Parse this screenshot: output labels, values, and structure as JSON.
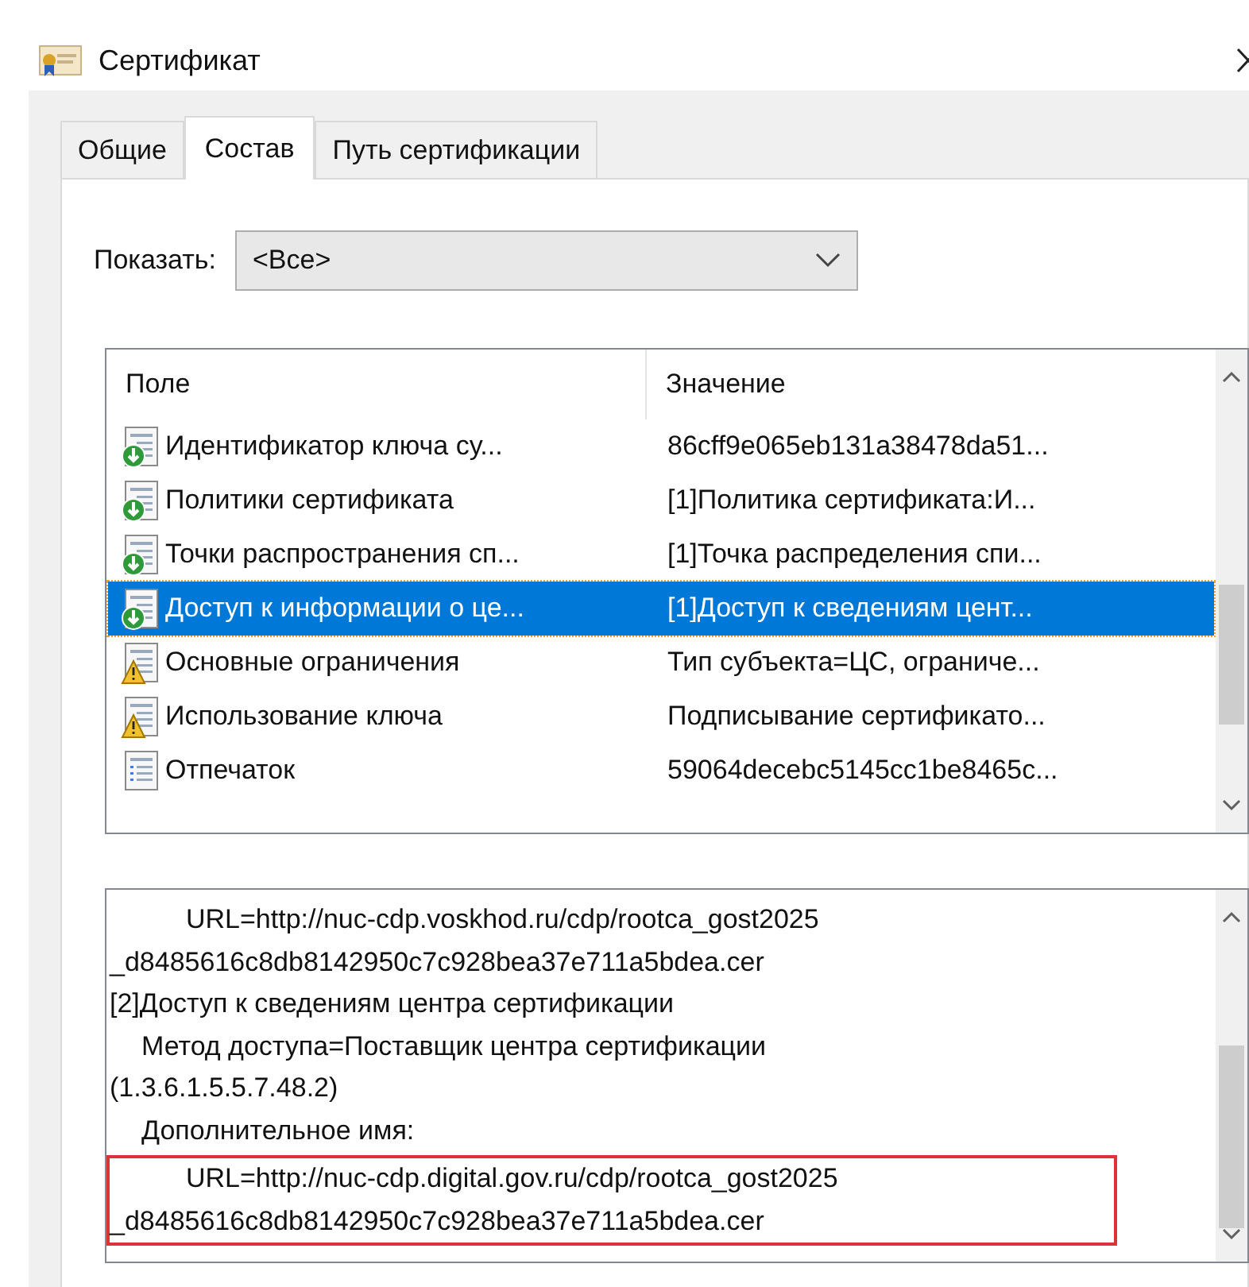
{
  "window": {
    "title": "Сертификат"
  },
  "tabs": [
    {
      "label": "Общие",
      "selected": false
    },
    {
      "label": "Состав",
      "selected": true
    },
    {
      "label": "Путь сертификации",
      "selected": false
    }
  ],
  "show": {
    "label": "Показать:",
    "value": "<Все>"
  },
  "fields": {
    "columns": [
      "Поле",
      "Значение"
    ],
    "rows": [
      {
        "kind": "extension",
        "name": "Идентификатор ключа су...",
        "value": "86cff9e065eb131a38478da51...",
        "selected": false
      },
      {
        "kind": "extension",
        "name": "Политики сертификата",
        "value": "[1]Политика сертификата:И...",
        "selected": false
      },
      {
        "kind": "extension",
        "name": "Точки распространения сп...",
        "value": "[1]Точка распределения спи...",
        "selected": false
      },
      {
        "kind": "extension",
        "name": "Доступ к информации о це...",
        "value": "[1]Доступ к сведениям цент...",
        "selected": true
      },
      {
        "kind": "critical",
        "name": "Основные ограничения",
        "value": "Тип субъекта=ЦС, ограниче...",
        "selected": false
      },
      {
        "kind": "critical",
        "name": "Использование ключа",
        "value": "Подписывание сертификато...",
        "selected": false
      },
      {
        "kind": "property",
        "name": "Отпечаток",
        "value": "59064decebc5145cc1be8465c...",
        "selected": false
      }
    ]
  },
  "detail": {
    "blocks": [
      {
        "highlighted": false,
        "lines": [
          {
            "kind": "deep",
            "text": "URL=http://nuc-cdp.voskhod.ru/cdp/rootca_gost2025"
          },
          {
            "kind": "plain",
            "text": "_d8485616c8db8142950c7c928bea37e711a5bdea.cer"
          },
          {
            "kind": "plain",
            "text": "[2]Доступ к сведениям центра сертификации"
          },
          {
            "kind": "nested",
            "text": "Метод доступа=Поставщик центра сертификации"
          },
          {
            "kind": "plain",
            "text": "(1.3.6.1.5.5.7.48.2)"
          },
          {
            "kind": "nested",
            "text": "Дополнительное имя:"
          }
        ]
      },
      {
        "highlighted": true,
        "lines": [
          {
            "kind": "deep",
            "text": "URL=http://nuc-cdp.digital.gov.ru/cdp/rootca_gost2025"
          },
          {
            "kind": "plain",
            "text": "_d8485616c8db8142950c7c928bea37e711a5bdea.cer"
          }
        ]
      }
    ]
  }
}
